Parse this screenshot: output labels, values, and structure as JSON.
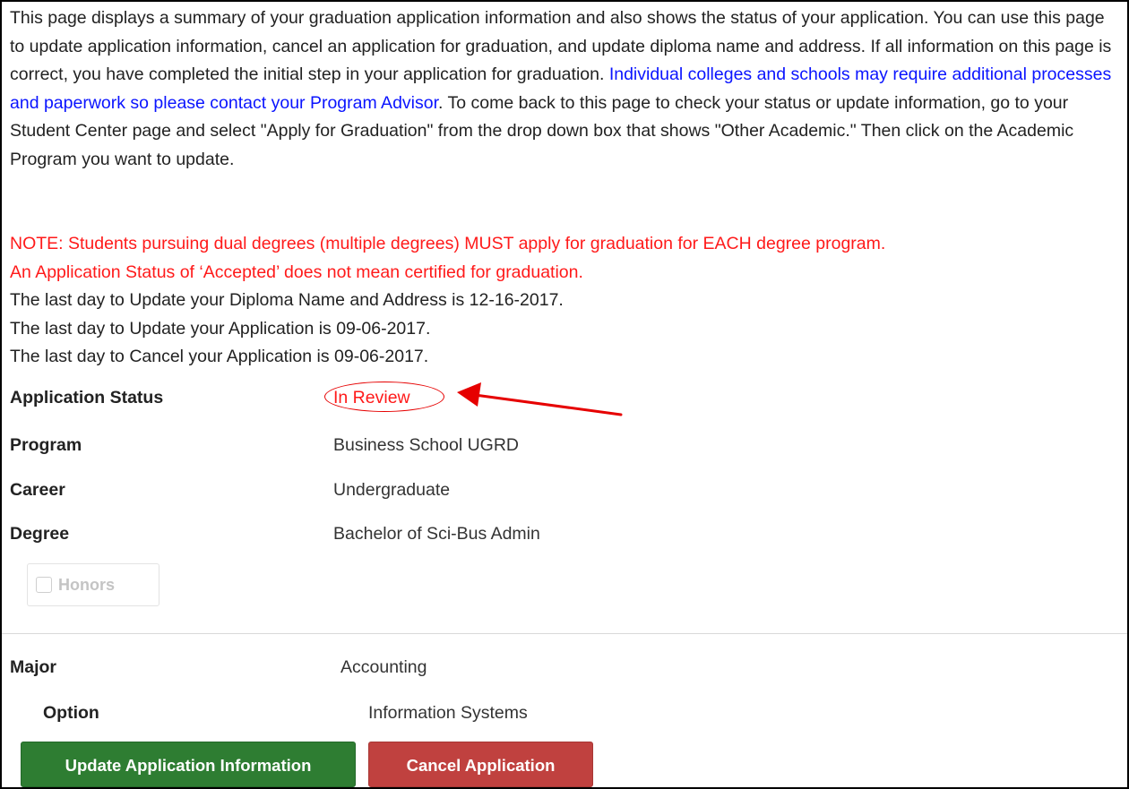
{
  "intro": {
    "part1": "This page displays a summary of your graduation application information and also shows the status of your application. You can use this page to update application information, cancel an application for graduation, and update diploma name and address. If all information on this page is correct, you have completed the initial step in your application for graduation. ",
    "blue": "Individual colleges and schools may require additional processes and paperwork so please contact your Program Advisor",
    "part2": ". To come back to this page to check your status or update information, go to your Student Center page and select \"Apply for Graduation\" from the drop down box that shows \"Other Academic.\" Then click on the Academic Program you want to update."
  },
  "notes": {
    "dual_degree": "NOTE: Students pursuing dual degrees (multiple degrees) MUST apply for graduation for EACH degree program.",
    "accepted": "An Application Status of ‘Accepted’ does not mean certified for graduation."
  },
  "deadlines": [
    "The last day to Update your Diploma Name and Address is 12-16-2017.",
    "The last day to Update your Application is 09-06-2017.",
    "The last day to Cancel your Application  is 09-06-2017."
  ],
  "details": {
    "status": {
      "label": "Application Status",
      "value": "In Review"
    },
    "program": {
      "label": "Program",
      "value": "Business School UGRD"
    },
    "career": {
      "label": "Career",
      "value": "Undergraduate"
    },
    "degree": {
      "label": "Degree",
      "value": "Bachelor of Sci-Bus Admin"
    }
  },
  "honors": {
    "label": "Honors",
    "checked": false
  },
  "major": {
    "label": "Major",
    "value": "Accounting"
  },
  "option": {
    "label": "Option",
    "value": "Information Systems"
  },
  "buttons": {
    "update": "Update Application Information",
    "cancel": "Cancel Application"
  },
  "colors": {
    "link_blue": "#0a14ff",
    "alert_red": "#ff1a1a",
    "update_green": "#2e7d32",
    "cancel_red": "#c0413f"
  },
  "icons": {
    "annotation_circle": "ellipse-outline",
    "annotation_arrow": "arrow-left"
  }
}
